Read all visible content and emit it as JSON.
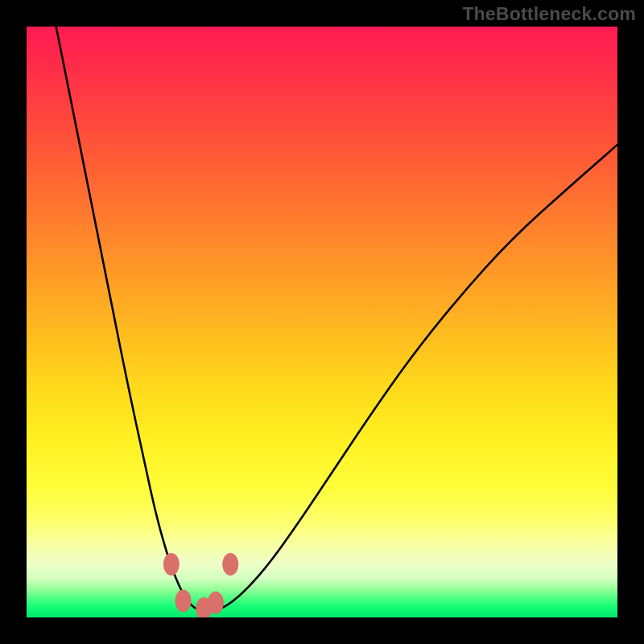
{
  "watermark": "TheBottleneck.com",
  "chart_data": {
    "type": "line",
    "title": "",
    "xlabel": "",
    "ylabel": "",
    "xlim": [
      0,
      100
    ],
    "ylim": [
      0,
      100
    ],
    "grid": false,
    "series": [
      {
        "name": "bottleneck-curve",
        "x": [
          5,
          8,
          11,
          14,
          17,
          20,
          22,
          24,
          25.5,
          27,
          28.5,
          30,
          32,
          34,
          37,
          41,
          46,
          52,
          58,
          65,
          73,
          82,
          92,
          100
        ],
        "y": [
          100,
          85,
          70,
          55,
          40,
          26,
          17,
          10,
          6,
          3,
          1.5,
          1,
          1.2,
          2,
          4.5,
          9,
          16,
          25,
          34,
          44,
          54,
          64,
          73,
          80
        ]
      },
      {
        "name": "markers",
        "points": [
          {
            "x": 24.5,
            "y": 9
          },
          {
            "x": 26.5,
            "y": 2.8
          },
          {
            "x": 30.0,
            "y": 1.5
          },
          {
            "x": 32.0,
            "y": 2.5
          },
          {
            "x": 34.5,
            "y": 9
          }
        ]
      }
    ],
    "gradient_stops": [
      {
        "pos": 0,
        "color": "#ff1a52"
      },
      {
        "pos": 50,
        "color": "#ffb020"
      },
      {
        "pos": 80,
        "color": "#fffd3a"
      },
      {
        "pos": 100,
        "color": "#00e86e"
      }
    ]
  }
}
